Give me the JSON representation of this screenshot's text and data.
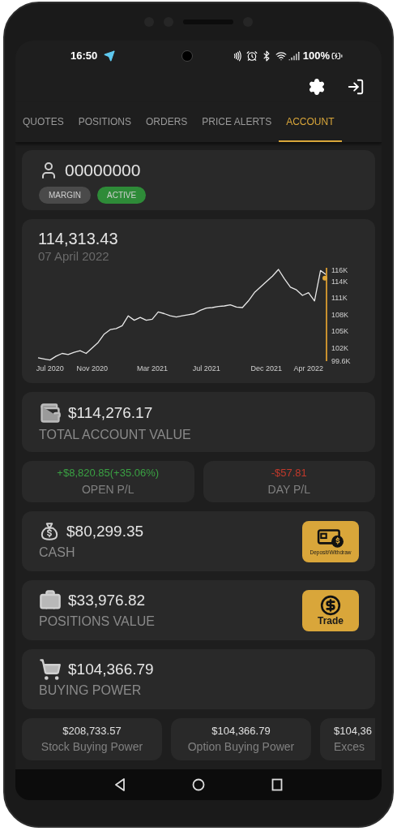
{
  "status_bar": {
    "time": "16:50",
    "battery": "100%"
  },
  "tabs": [
    {
      "label": "QUOTES",
      "selected": false
    },
    {
      "label": "POSITIONS",
      "selected": false
    },
    {
      "label": "ORDERS",
      "selected": false
    },
    {
      "label": "PRICE ALERTS",
      "selected": false
    },
    {
      "label": "ACCOUNT",
      "selected": true
    }
  ],
  "account": {
    "number": "00000000",
    "badges": [
      {
        "label": "MARGIN",
        "color": "#4a4a4a"
      },
      {
        "label": "ACTIVE",
        "color": "#2e8b38"
      }
    ]
  },
  "chart_card": {
    "value": "114,313.43",
    "date": "07 April 2022",
    "chart_data": {
      "type": "line",
      "categories": [
        null,
        null,
        "Jul 2020",
        null,
        null,
        null,
        null,
        null,
        null,
        "Nov 2020",
        null,
        null,
        null,
        null,
        null,
        null,
        null,
        null,
        null,
        "Mar 2021",
        null,
        null,
        null,
        null,
        null,
        null,
        null,
        null,
        "Jul 2021",
        null,
        null,
        null,
        null,
        null,
        null,
        null,
        null,
        null,
        "Dec 2021",
        null,
        null,
        null,
        null,
        null,
        null,
        "Apr 2022",
        null,
        null,
        null
      ],
      "series": [
        {
          "color": "#e8e8e8",
          "values": [
            100.2,
            100,
            99.8,
            100.5,
            101,
            100.8,
            101.2,
            101.5,
            101,
            102,
            103,
            104.5,
            105.3,
            105.5,
            106,
            107.8,
            107,
            107.5,
            107,
            107.2,
            108.5,
            108.2,
            107.8,
            107.6,
            107.8,
            108,
            108.2,
            108.8,
            109.2,
            109.3,
            109.5,
            109.6,
            109.8,
            109.4,
            109.3,
            110.5,
            112,
            113,
            114,
            115,
            116.2,
            114.5,
            113,
            112.5,
            111.5,
            112,
            110.5,
            116,
            115.2
          ]
        }
      ],
      "ylim": [
        99.6,
        116.5
      ],
      "yticks": [
        {
          "value": 116,
          "label": "116K"
        },
        {
          "value": 114,
          "label": "114K"
        },
        {
          "value": 111,
          "label": "111K"
        },
        {
          "value": 108,
          "label": "108K"
        },
        {
          "value": 105,
          "label": "105K"
        },
        {
          "value": 102,
          "label": "102K"
        },
        {
          "value": 99.6,
          "label": "99.6K"
        }
      ]
    }
  },
  "total": {
    "value": "$114,276.17",
    "label": "TOTAL ACCOUNT VALUE"
  },
  "pnl": [
    {
      "value": "+$8,820.85(+35.06%)",
      "label": "OPEN P/L",
      "kind": "gain"
    },
    {
      "value": "-$57.81",
      "label": "DAY P/L",
      "kind": "loss"
    }
  ],
  "metrics": [
    {
      "value": "$80,299.35",
      "label": "CASH",
      "action": {
        "kind": "deposit",
        "label": "Deposit/Withdraw"
      }
    },
    {
      "value": "$33,976.82",
      "label": "POSITIONS VALUE",
      "action": {
        "kind": "trade",
        "label": "Trade"
      }
    },
    {
      "value": "$104,366.79",
      "label": "BUYING POWER"
    }
  ],
  "power_cards": [
    {
      "value": "$208,733.57",
      "label": "Stock Buying Power",
      "cut": false
    },
    {
      "value": "$104,366.79",
      "label": "Option Buying Power",
      "cut": false
    },
    {
      "value": "$104,36",
      "label": "Exces",
      "cut": true
    }
  ]
}
